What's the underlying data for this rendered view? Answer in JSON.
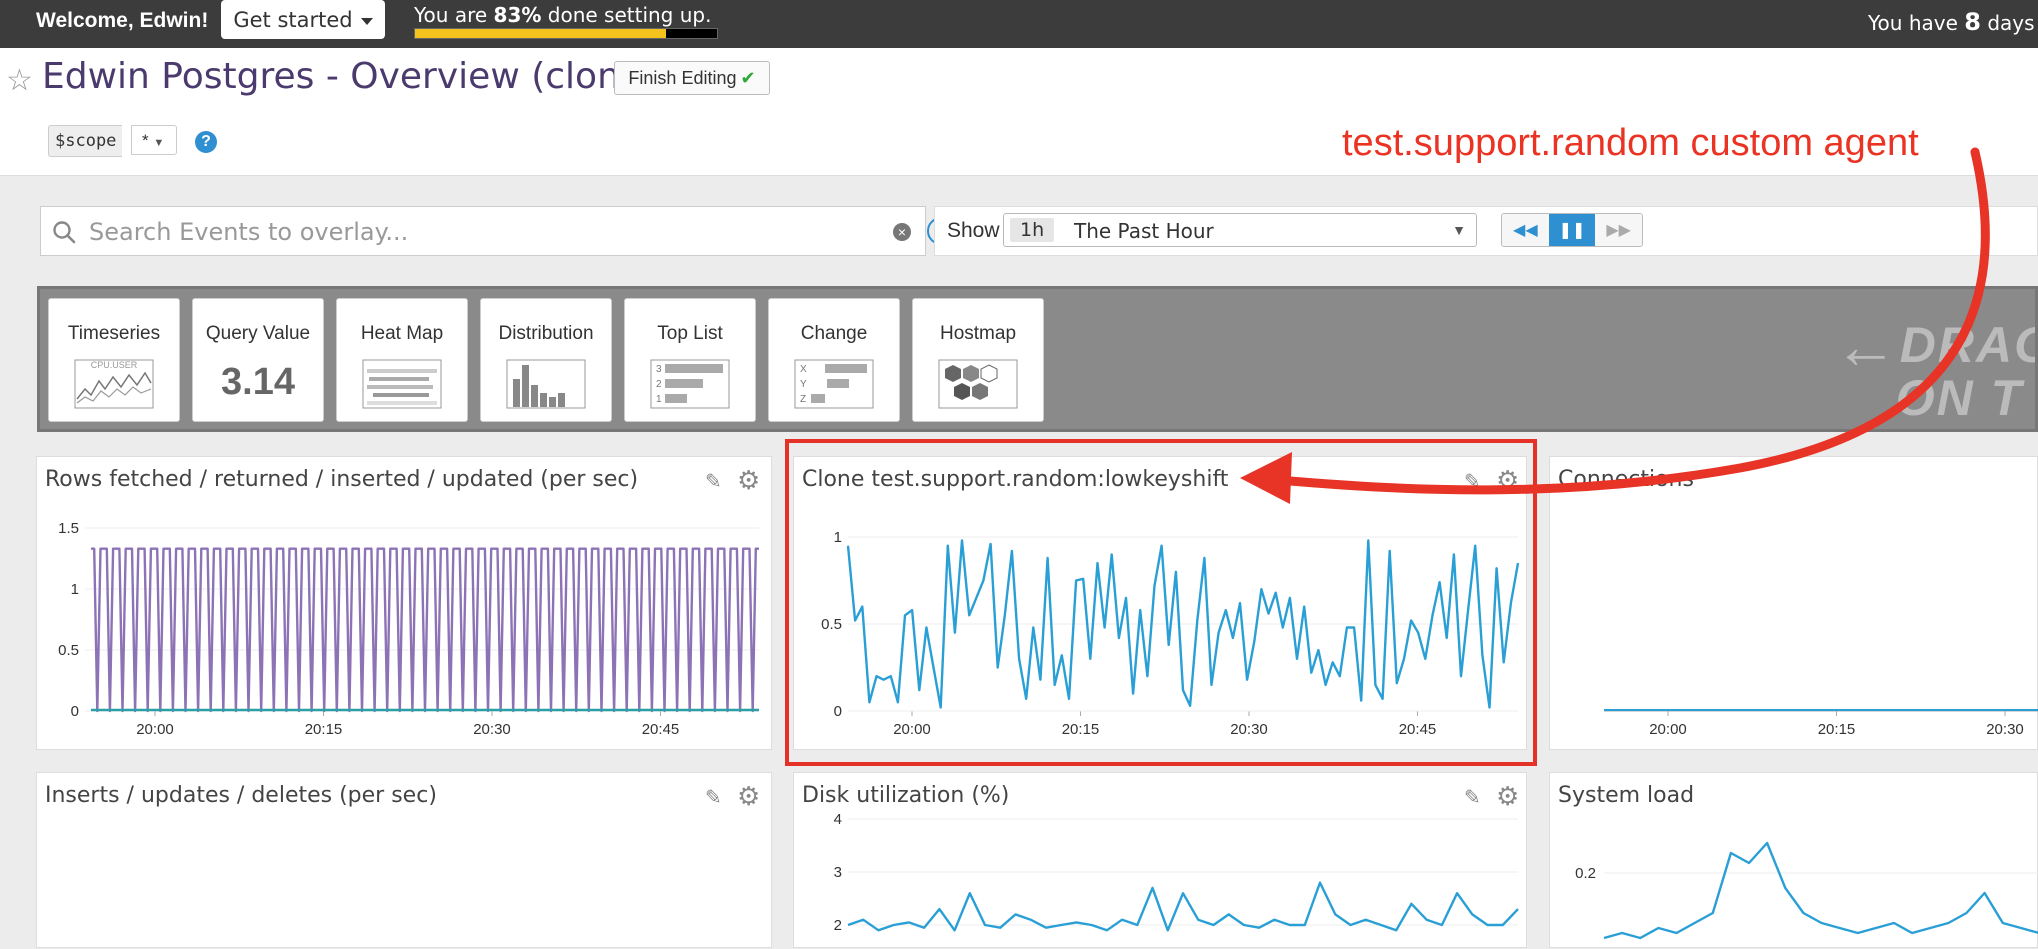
{
  "topbar": {
    "welcome": "Welcome, Edwin!",
    "get_started": "Get started",
    "progress_prefix": "You are ",
    "progress_percent": "83%",
    "progress_suffix": " done setting up.",
    "progress_fraction": 0.83,
    "trial_prefix": "You have ",
    "trial_days": "8",
    "trial_suffix": " days l"
  },
  "header": {
    "title": "Edwin Postgres - Overview (cloned)",
    "finish_editing": "Finish Editing",
    "scope_label": "$scope",
    "scope_value": "*",
    "help": "?"
  },
  "annotation": {
    "text": "test.support.random custom agent",
    "color": "#ea3323"
  },
  "search": {
    "placeholder": "Search Events to overlay..."
  },
  "timeframe": {
    "show_label": "Show",
    "badge": "1h",
    "value": "The Past Hour"
  },
  "widgets": [
    {
      "label": "Timeseries",
      "icon": "timeseries-icon",
      "icon_text": "CPU.USER"
    },
    {
      "label": "Query Value",
      "icon": "query-value-icon",
      "value_text": "3.14"
    },
    {
      "label": "Heat Map",
      "icon": "heat-map-icon"
    },
    {
      "label": "Distribution",
      "icon": "distribution-icon"
    },
    {
      "label": "Top List",
      "icon": "top-list-icon",
      "rows": [
        "3",
        "2",
        "1"
      ]
    },
    {
      "label": "Change",
      "icon": "change-icon",
      "rows": [
        "X",
        "Y",
        "Z"
      ]
    },
    {
      "label": "Hostmap",
      "icon": "hostmap-icon"
    }
  ],
  "drag_hint": {
    "line1": "DRAG",
    "line2": "ON T"
  },
  "panels": {
    "rows": {
      "title": "Rows fetched / returned / inserted / updated (per sec)"
    },
    "clone": {
      "title": "Clone test.support.random:lowkeyshift"
    },
    "connections": {
      "title": "Connections"
    },
    "inserts": {
      "title": "Inserts / updates / deletes (per sec)"
    },
    "disk": {
      "title": "Disk utilization (%)"
    },
    "load": {
      "title": "System load"
    }
  },
  "chart_data": [
    {
      "type": "line",
      "panel": "rows",
      "x_ticks": [
        "20:00",
        "20:15",
        "20:30",
        "20:45"
      ],
      "y_ticks": [
        "0",
        "0.5",
        "1",
        "1.5"
      ],
      "ylim": [
        0,
        1.5
      ],
      "color": "#8c73b5",
      "pattern": "square-wave",
      "cycles": 53,
      "high": 1.33,
      "low": 0
    },
    {
      "type": "line",
      "panel": "clone",
      "x_ticks": [
        "20:00",
        "20:15",
        "20:30",
        "20:45"
      ],
      "y_ticks": [
        "0",
        "0.5",
        "1"
      ],
      "ylim": [
        0,
        1
      ],
      "color": "#2a9fd6",
      "values": [
        0.95,
        0.52,
        0.6,
        0.05,
        0.2,
        0.18,
        0.2,
        0.05,
        0.55,
        0.58,
        0.12,
        0.48,
        0.25,
        0.02,
        0.95,
        0.45,
        0.98,
        0.55,
        0.65,
        0.75,
        0.96,
        0.25,
        0.55,
        0.92,
        0.3,
        0.07,
        0.48,
        0.18,
        0.88,
        0.15,
        0.32,
        0.07,
        0.75,
        0.76,
        0.3,
        0.85,
        0.48,
        0.9,
        0.42,
        0.65,
        0.1,
        0.58,
        0.2,
        0.72,
        0.95,
        0.38,
        0.8,
        0.12,
        0.03,
        0.52,
        0.88,
        0.15,
        0.45,
        0.58,
        0.42,
        0.62,
        0.18,
        0.4,
        0.7,
        0.56,
        0.68,
        0.48,
        0.65,
        0.3,
        0.6,
        0.22,
        0.35,
        0.15,
        0.28,
        0.2,
        0.48,
        0.48,
        0.06,
        0.98,
        0.15,
        0.07,
        0.92,
        0.16,
        0.3,
        0.52,
        0.45,
        0.3,
        0.55,
        0.74,
        0.42,
        0.9,
        0.2,
        0.58,
        0.95,
        0.32,
        0.02,
        0.82,
        0.28,
        0.62,
        0.85
      ]
    },
    {
      "type": "line",
      "panel": "connections",
      "x_ticks": [
        "20:00",
        "20:15",
        "20:30"
      ],
      "color": "#2a9fd6",
      "values": [
        0,
        0,
        0,
        0,
        0
      ]
    },
    {
      "type": "line",
      "panel": "disk",
      "y_ticks": [
        "2",
        "3",
        "4"
      ],
      "ylim": [
        2,
        4
      ],
      "color": "#2a9fd6",
      "values": [
        2.0,
        2.1,
        1.9,
        2.0,
        2.05,
        1.95,
        2.3,
        1.9,
        2.6,
        2.0,
        1.95,
        2.2,
        2.1,
        1.95,
        2.0,
        2.05,
        2.0,
        1.9,
        2.1,
        2.0,
        2.7,
        1.9,
        2.6,
        2.1,
        2.0,
        2.2,
        2.0,
        1.95,
        2.1,
        2.0,
        2.0,
        2.8,
        2.2,
        2.0,
        2.1,
        2.0,
        1.9,
        2.4,
        2.1,
        2.0,
        2.6,
        2.2,
        2.0,
        2.0,
        2.3
      ]
    },
    {
      "type": "line",
      "panel": "load",
      "y_ticks": [
        "0.2"
      ],
      "color": "#2a9fd6",
      "values": [
        0.05,
        0.06,
        0.05,
        0.07,
        0.06,
        0.08,
        0.1,
        0.22,
        0.2,
        0.24,
        0.15,
        0.1,
        0.08,
        0.07,
        0.06,
        0.07,
        0.08,
        0.06,
        0.07,
        0.08,
        0.1,
        0.14,
        0.08,
        0.07,
        0.06
      ]
    }
  ]
}
